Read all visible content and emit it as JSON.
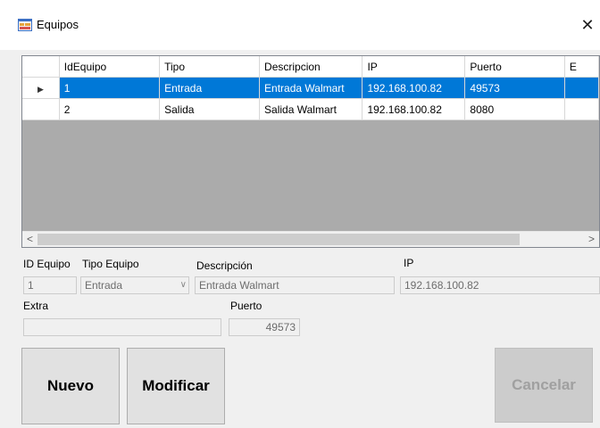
{
  "window": {
    "title": "Equipos",
    "close_glyph": "✕"
  },
  "grid": {
    "columns": [
      "IdEquipo",
      "Tipo",
      "Descripcion",
      "IP",
      "Puerto",
      "E"
    ],
    "rows": [
      {
        "selected": true,
        "cells": [
          "1",
          "Entrada",
          "Entrada Walmart",
          "192.168.100.82",
          "49573"
        ]
      },
      {
        "selected": false,
        "cells": [
          "2",
          "Salida",
          "Salida Walmart",
          "192.168.100.82",
          "8080"
        ]
      }
    ],
    "row_indicator": "▶",
    "scroll_left": "<",
    "scroll_right": ">"
  },
  "form": {
    "id_equipo": {
      "label": "ID Equipo",
      "value": "1"
    },
    "tipo_equipo": {
      "label": "Tipo Equipo",
      "value": "Entrada"
    },
    "descripcion": {
      "label": "Descripción",
      "value": "Entrada Walmart"
    },
    "ip": {
      "label": "IP",
      "value": "192.168.100.82"
    },
    "extra": {
      "label": "Extra",
      "value": ""
    },
    "puerto": {
      "label": "Puerto",
      "value": "49573"
    }
  },
  "buttons": {
    "nuevo": "Nuevo",
    "modificar": "Modificar",
    "cancelar": "Cancelar"
  },
  "colors": {
    "selection": "#0078d7",
    "grid_background": "#ababab"
  }
}
